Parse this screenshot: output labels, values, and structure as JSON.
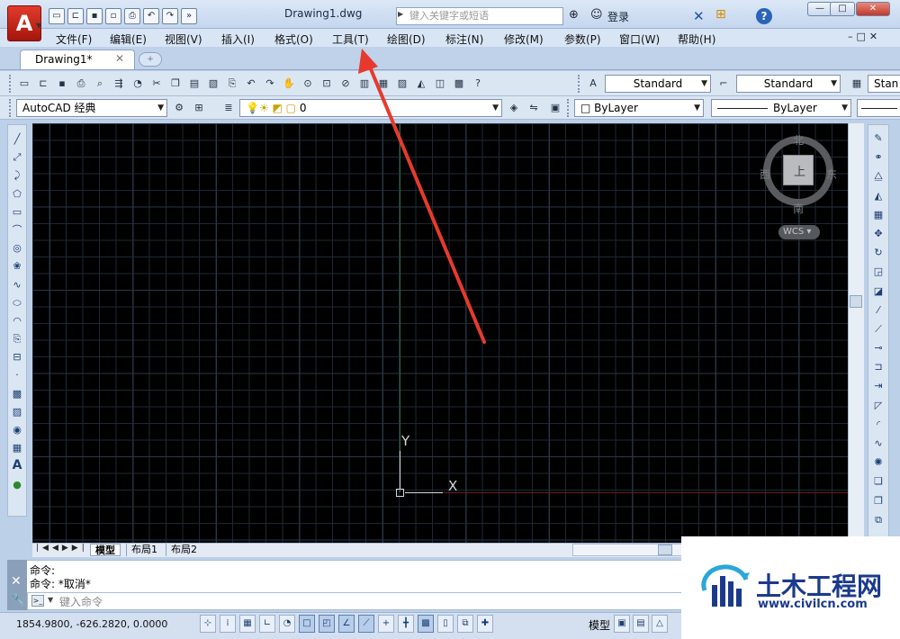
{
  "title_bar": {
    "app_logo": "A",
    "doc_title": "Drawing1.dwg",
    "search_placeholder": "键入关键字或短语",
    "login": "登录",
    "minimize": "—",
    "maximize": "□",
    "close": "✕"
  },
  "menu": [
    "文件(F)",
    "编辑(E)",
    "视图(V)",
    "插入(I)",
    "格式(O)",
    "工具(T)",
    "绘图(D)",
    "标注(N)",
    "修改(M)",
    "参数(P)",
    "窗口(W)",
    "帮助(H)"
  ],
  "tabs": {
    "active": "Drawing1*",
    "close": "✕"
  },
  "toolbar": {
    "text_style": "Standard",
    "dim_style": "Standard",
    "table_style": "Stan",
    "workspace": "AutoCAD 经典",
    "layer": "0",
    "color": "ByLayer",
    "linetype": "ByLayer"
  },
  "viewcube": {
    "north": "北",
    "south": "南",
    "west": "西",
    "east": "东",
    "face": "上",
    "wcs": "WCS"
  },
  "ucs": {
    "x_label": "X",
    "y_label": "Y"
  },
  "layout_tabs": [
    "模型",
    "布局1",
    "布局2"
  ],
  "command": {
    "line1": "命令:",
    "line2": "命令: *取消*",
    "input_placeholder": "键入命令"
  },
  "status": {
    "coordinates": "1854.9800,   -626.2820, 0.0000",
    "model_label": "模型"
  },
  "watermark": {
    "name": "土木工程网",
    "url": "www.civilcn.com"
  },
  "colors": {
    "accent_red": "#e63a2e",
    "canvas": "#000000",
    "chrome": "#dbe6f3"
  }
}
